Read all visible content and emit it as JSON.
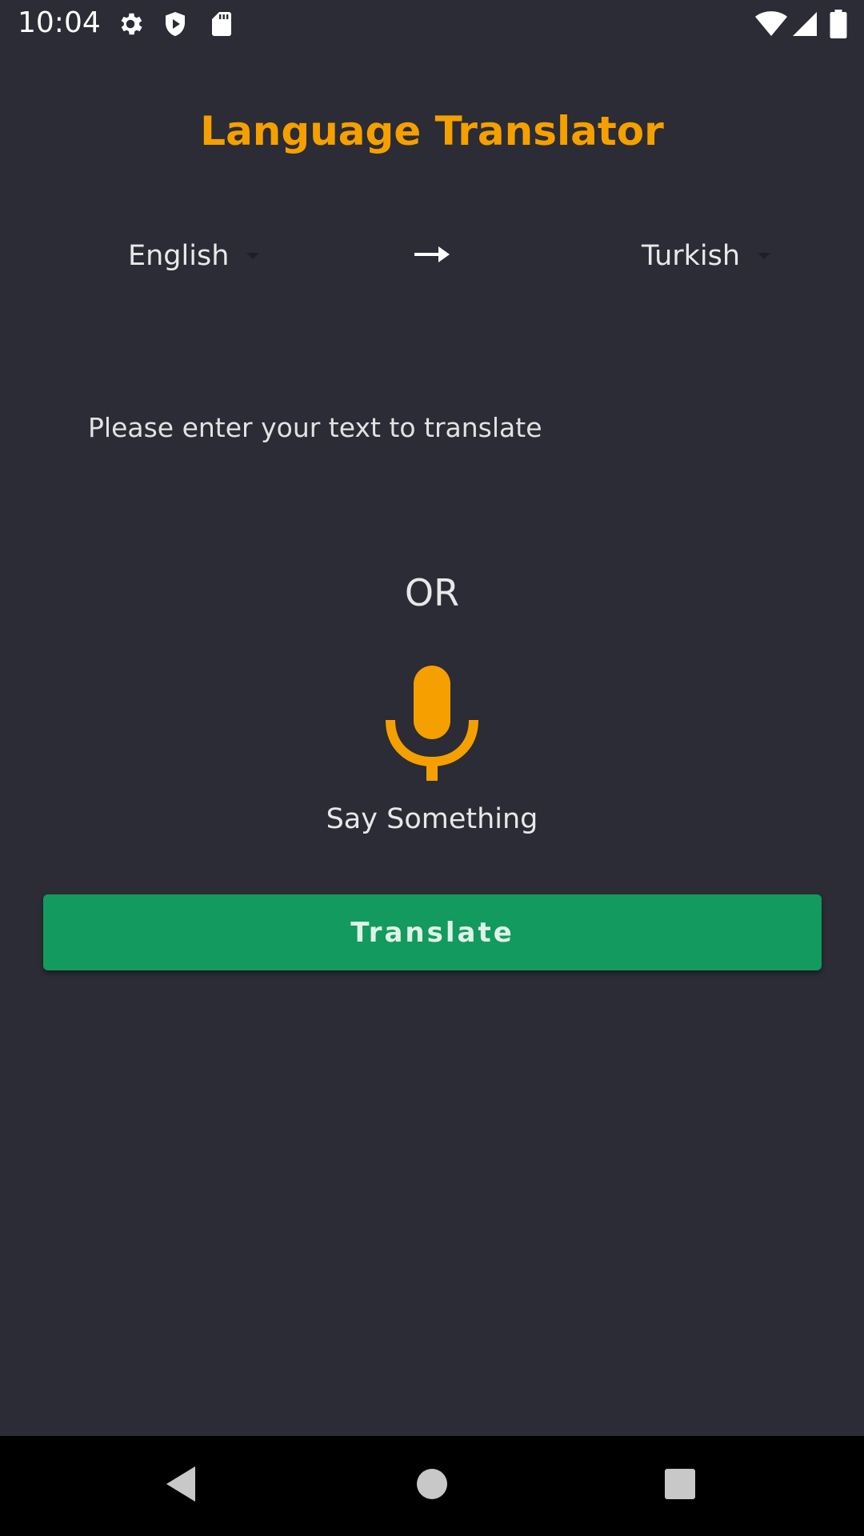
{
  "status_bar": {
    "time": "10:04",
    "icons": [
      "settings-icon",
      "shield-icon",
      "sd-card-icon",
      "wifi-icon",
      "signal-icon",
      "battery-icon"
    ]
  },
  "app": {
    "title": "Language Translator",
    "title_color": "#f5a000"
  },
  "languages": {
    "source": "English",
    "target": "Turkish"
  },
  "input": {
    "placeholder": "Please enter your text to translate"
  },
  "separator": "OR",
  "voice": {
    "label": "Say Something",
    "icon": "microphone-icon",
    "color": "#f5a000"
  },
  "translate_button": {
    "label": "Translate",
    "color": "#139a5e"
  },
  "nav_bar": {
    "buttons": [
      "back-icon",
      "home-icon",
      "recents-icon"
    ]
  }
}
